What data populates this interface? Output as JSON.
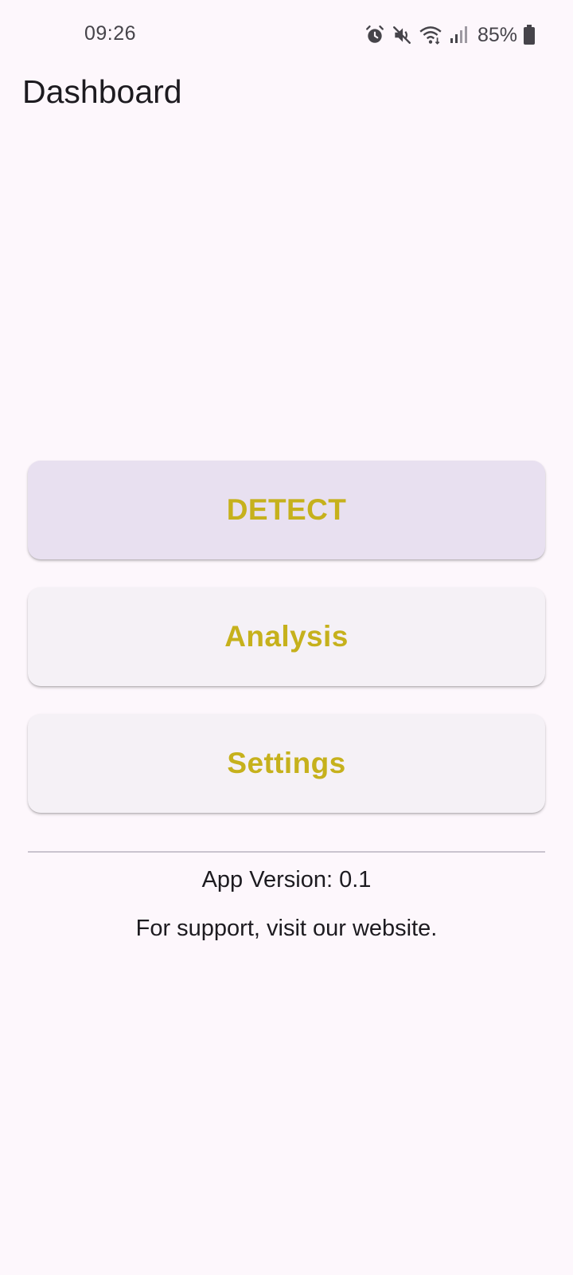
{
  "status_bar": {
    "time": "09:26",
    "battery_percent": "85%",
    "icons": [
      "alarm-icon",
      "mute-icon",
      "wifi-icon",
      "signal-icon",
      "battery-icon"
    ]
  },
  "app_bar": {
    "title": "Dashboard"
  },
  "buttons": {
    "detect": "DETECT",
    "analysis": "Analysis",
    "settings": "Settings"
  },
  "footer": {
    "version": "App Version: 0.1",
    "support": "For support, visit our website."
  },
  "colors": {
    "background": "#FDF7FC",
    "button_text": "#C6B11C",
    "detect_button_bg": "#E8E0F0",
    "button_bg": "#F5F1F6"
  }
}
